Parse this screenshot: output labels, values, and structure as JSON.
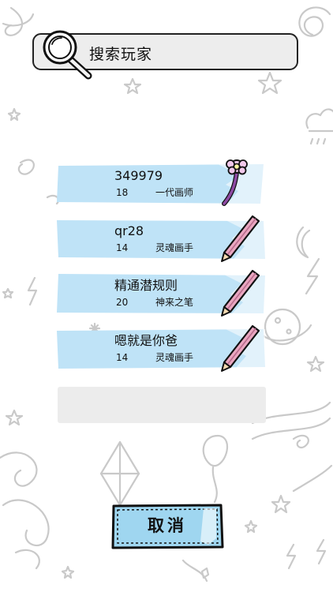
{
  "search": {
    "title": "搜索玩家"
  },
  "players": [
    {
      "name": "349979",
      "level": "18",
      "title": "一代画师",
      "icon": "flower-wand-icon"
    },
    {
      "name": "qr28",
      "level": "14",
      "title": "灵魂画手",
      "icon": "pencil-icon"
    },
    {
      "name": "精通潜规则",
      "level": "20",
      "title": "神来之笔",
      "icon": "pencil-icon"
    },
    {
      "name": "嗯就是你爸",
      "level": "14",
      "title": "灵魂画手",
      "icon": "pencil-icon"
    }
  ],
  "cancel": {
    "label": "取消"
  },
  "colors": {
    "card_blue": "#bfe3f7",
    "button_blue": "#9fd6f0",
    "search_bg": "#ededed",
    "empty_slot": "#ececec",
    "doodle_gray": "#c8c8c8",
    "pencil_pink": "#e9a6c0",
    "wand_purple": "#8d4aa3"
  }
}
